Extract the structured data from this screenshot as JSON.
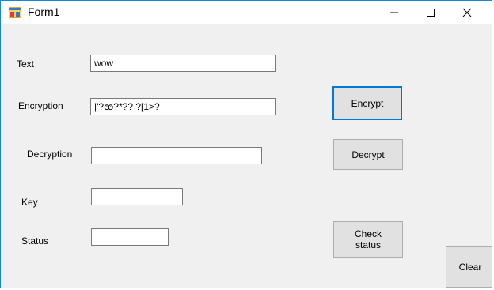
{
  "window": {
    "title": "Form1",
    "icon": "winforms-app-icon"
  },
  "controls": {
    "minimize_icon": "minimize-icon",
    "maximize_icon": "maximize-icon",
    "close_icon": "close-icon"
  },
  "fields": {
    "text_label": "Text",
    "text_value": "wow",
    "encryption_label": "Encryption",
    "encryption_value": "|'?ꙭ?*??   ?[1>?",
    "decryption_label": "Decryption",
    "decryption_value": "",
    "key_label": "Key",
    "key_value": "",
    "status_label": "Status",
    "status_value": ""
  },
  "buttons": {
    "encrypt": "Encrypt",
    "decrypt": "Decrypt",
    "check_status": "Check\nstatus",
    "clear": "Clear"
  },
  "colors": {
    "accent": "#0078d7",
    "window_border": "#1883d7",
    "form_bg": "#f0f0f0",
    "button_bg": "#e1e1e1"
  }
}
